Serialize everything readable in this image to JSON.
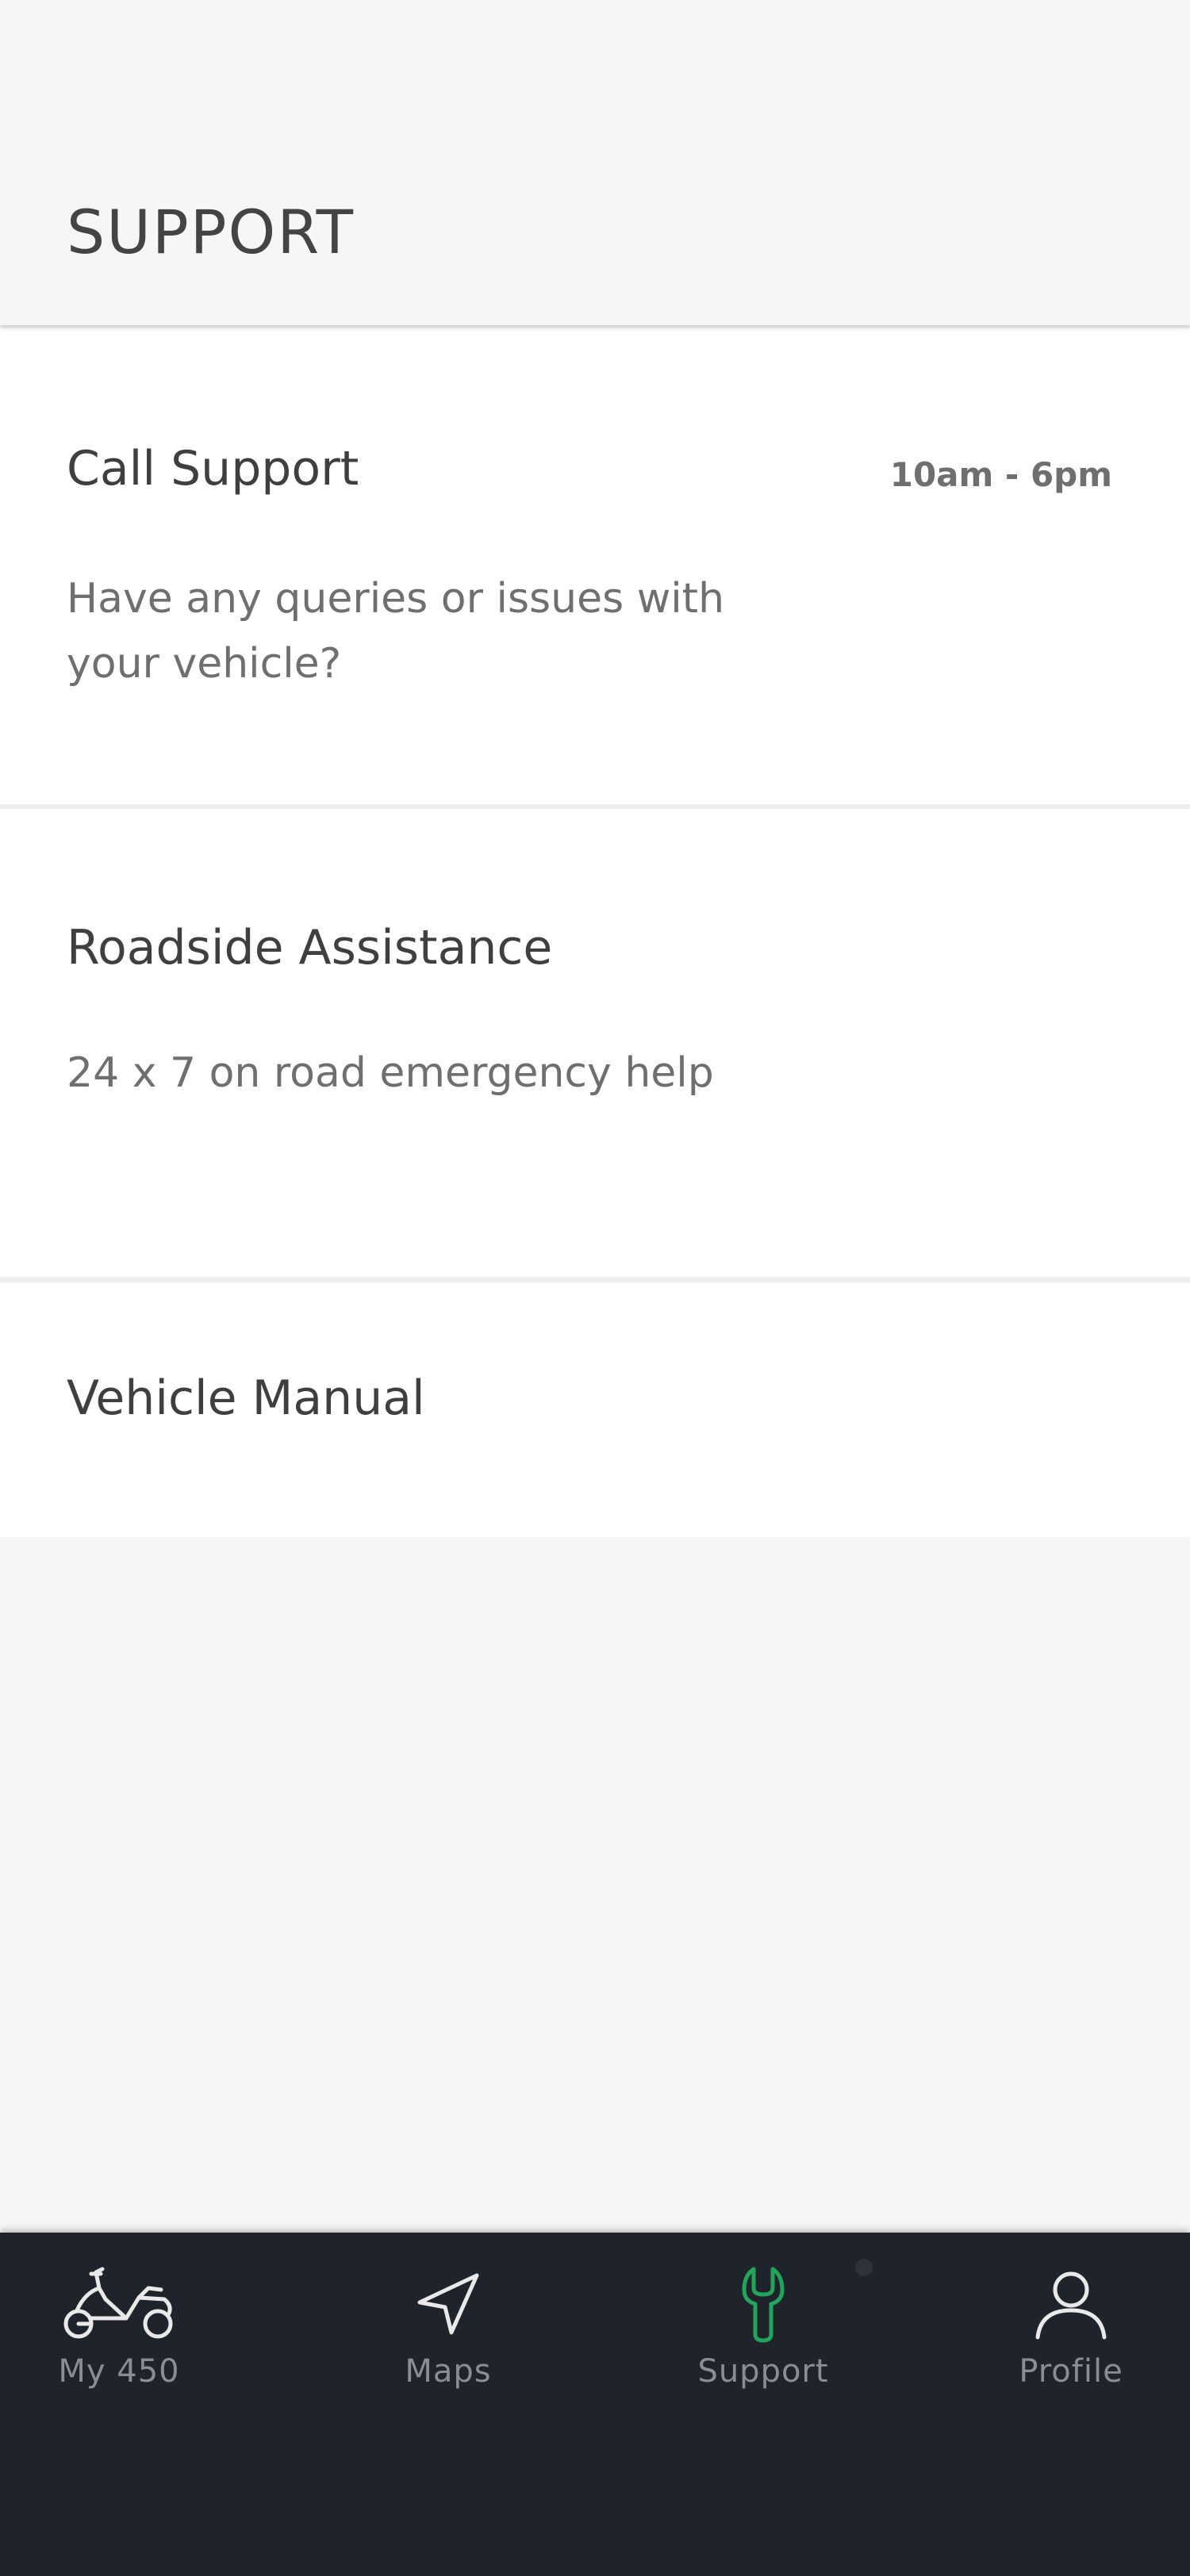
{
  "header": {
    "title": "SUPPORT"
  },
  "cards": {
    "call": {
      "title": "Call Support",
      "hours": "10am - 6pm",
      "description": "Have any queries or issues with your vehicle?"
    },
    "roadside": {
      "title": "Roadside Assistance",
      "description": "24 x 7 on road emergency help"
    },
    "manual": {
      "title": "Vehicle Manual"
    }
  },
  "bottom_nav": {
    "items": [
      {
        "label": "My 450",
        "icon": "scooter-icon",
        "active": false
      },
      {
        "label": "Maps",
        "icon": "navigation-arrow-icon",
        "active": false
      },
      {
        "label": "Support",
        "icon": "wrench-icon",
        "active": true
      },
      {
        "label": "Profile",
        "icon": "person-icon",
        "active": false
      }
    ]
  },
  "colors": {
    "background": "#f6f6f6",
    "card": "#ffffff",
    "nav_background": "#1f232b",
    "accent": "#22a45a",
    "title_text": "#444444",
    "secondary_text": "#6f6f6f"
  }
}
